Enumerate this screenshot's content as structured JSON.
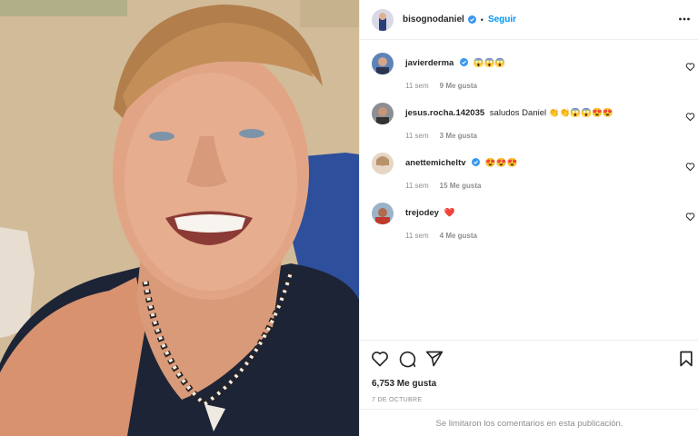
{
  "post": {
    "username": "bisognodaniel",
    "follow_label": "Seguir",
    "separator": "•"
  },
  "comments": [
    {
      "user": "javierderma",
      "verified": true,
      "text": "😱😱😱",
      "time": "11 sem",
      "likes": "9 Me gusta"
    },
    {
      "user": "jesus.rocha.142035",
      "verified": false,
      "text": "saludos Daniel 👏👏😱😱😍😍",
      "time": "11 sem",
      "likes": "3 Me gusta"
    },
    {
      "user": "anettemicheltv",
      "verified": true,
      "text": "😍😍😍",
      "time": "11 sem",
      "likes": "15 Me gusta"
    },
    {
      "user": "trejodey",
      "verified": false,
      "text": "❤️",
      "time": "11 sem",
      "likes": "4 Me gusta"
    }
  ],
  "footer": {
    "likes": "6,753 Me gusta",
    "date": "7 DE OCTUBRE",
    "comments_limited": "Se limitaron los comentarios en esta publicación."
  },
  "icons": {
    "more": "more-options-icon",
    "like": "heart-icon",
    "comment": "comment-icon",
    "share": "share-icon",
    "save": "bookmark-icon",
    "verified": "verified-badge-icon"
  },
  "colors": {
    "accent": "#0095f6",
    "muted": "#8e8e8e",
    "text": "#262626"
  }
}
